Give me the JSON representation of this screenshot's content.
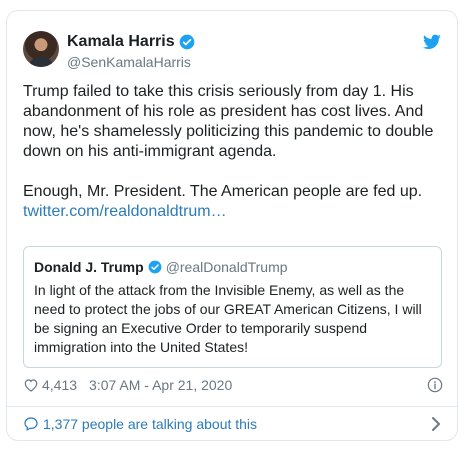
{
  "tweet": {
    "author_name": "Kamala Harris",
    "author_handle": "@SenKamalaHarris",
    "text": "Trump failed to take this crisis seriously from day 1. His abandonment of his role as president has cost lives. And now, he's shamelessly politicizing this pandemic to double down on his anti-immigrant agenda.\n\nEnough, Mr. President. The American people are fed up.",
    "link": "twitter.com/realdonaldtrum…",
    "likes": "4,413",
    "timestamp": "3:07 AM - Apr 21, 2020",
    "talking": "1,377 people are talking about this"
  },
  "quoted": {
    "author_name": "Donald J. Trump",
    "author_handle": "@realDonaldTrump",
    "text": "In light of the attack from the Invisible Enemy, as well as the need to protect the jobs of our GREAT American Citizens, I will be signing an Executive Order to temporarily suspend immigration into the United States!"
  },
  "icons": {
    "verified": "verified-badge-icon",
    "brand": "twitter-bird-icon",
    "like": "heart-icon",
    "info": "info-icon",
    "reply": "speech-bubble-icon",
    "more": "chevron-right-icon"
  },
  "colors": {
    "link": "#2b7bb9",
    "muted": "#697882",
    "verified": "#1da1f2",
    "border": "#e1e8ed"
  }
}
